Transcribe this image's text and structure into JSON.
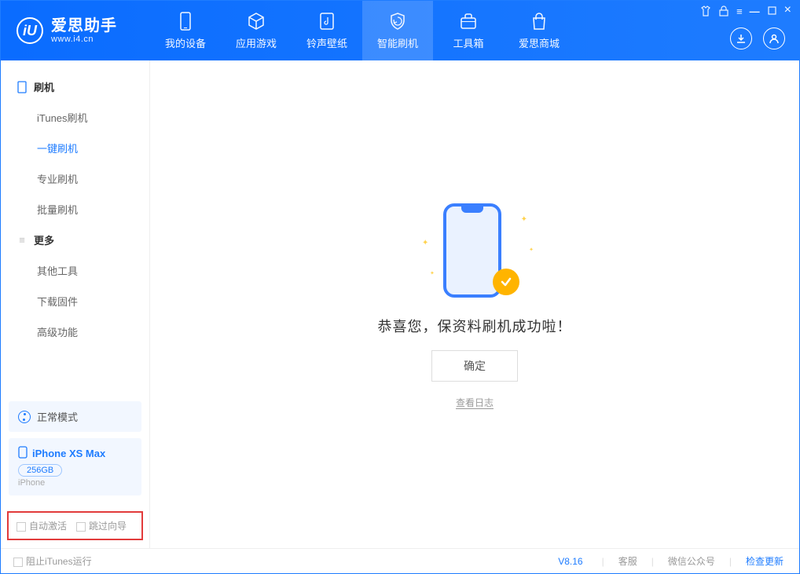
{
  "app": {
    "title": "爱思助手",
    "subtitle": "www.i4.cn"
  },
  "tabs": [
    {
      "label": "我的设备",
      "icon": "phone-icon"
    },
    {
      "label": "应用游戏",
      "icon": "cube-icon"
    },
    {
      "label": "铃声壁纸",
      "icon": "music-icon"
    },
    {
      "label": "智能刷机",
      "icon": "shield-icon"
    },
    {
      "label": "工具箱",
      "icon": "toolbox-icon"
    },
    {
      "label": "爱思商城",
      "icon": "bag-icon"
    }
  ],
  "active_tab": 3,
  "sidebar": {
    "group1_label": "刷机",
    "items1": [
      "iTunes刷机",
      "一键刷机",
      "专业刷机",
      "批量刷机"
    ],
    "active1": 1,
    "group2_label": "更多",
    "items2": [
      "其他工具",
      "下载固件",
      "高级功能"
    ]
  },
  "status": {
    "mode": "正常模式"
  },
  "device": {
    "name": "iPhone XS Max",
    "storage": "256GB",
    "type": "iPhone"
  },
  "checks": {
    "auto_activate": "自动激活",
    "skip_guide": "跳过向导"
  },
  "main": {
    "message": "恭喜您，保资料刷机成功啦！",
    "ok": "确定",
    "log_link": "查看日志"
  },
  "footer": {
    "block_itunes": "阻止iTunes运行",
    "version": "V8.16",
    "links": [
      "客服",
      "微信公众号",
      "检查更新"
    ]
  }
}
